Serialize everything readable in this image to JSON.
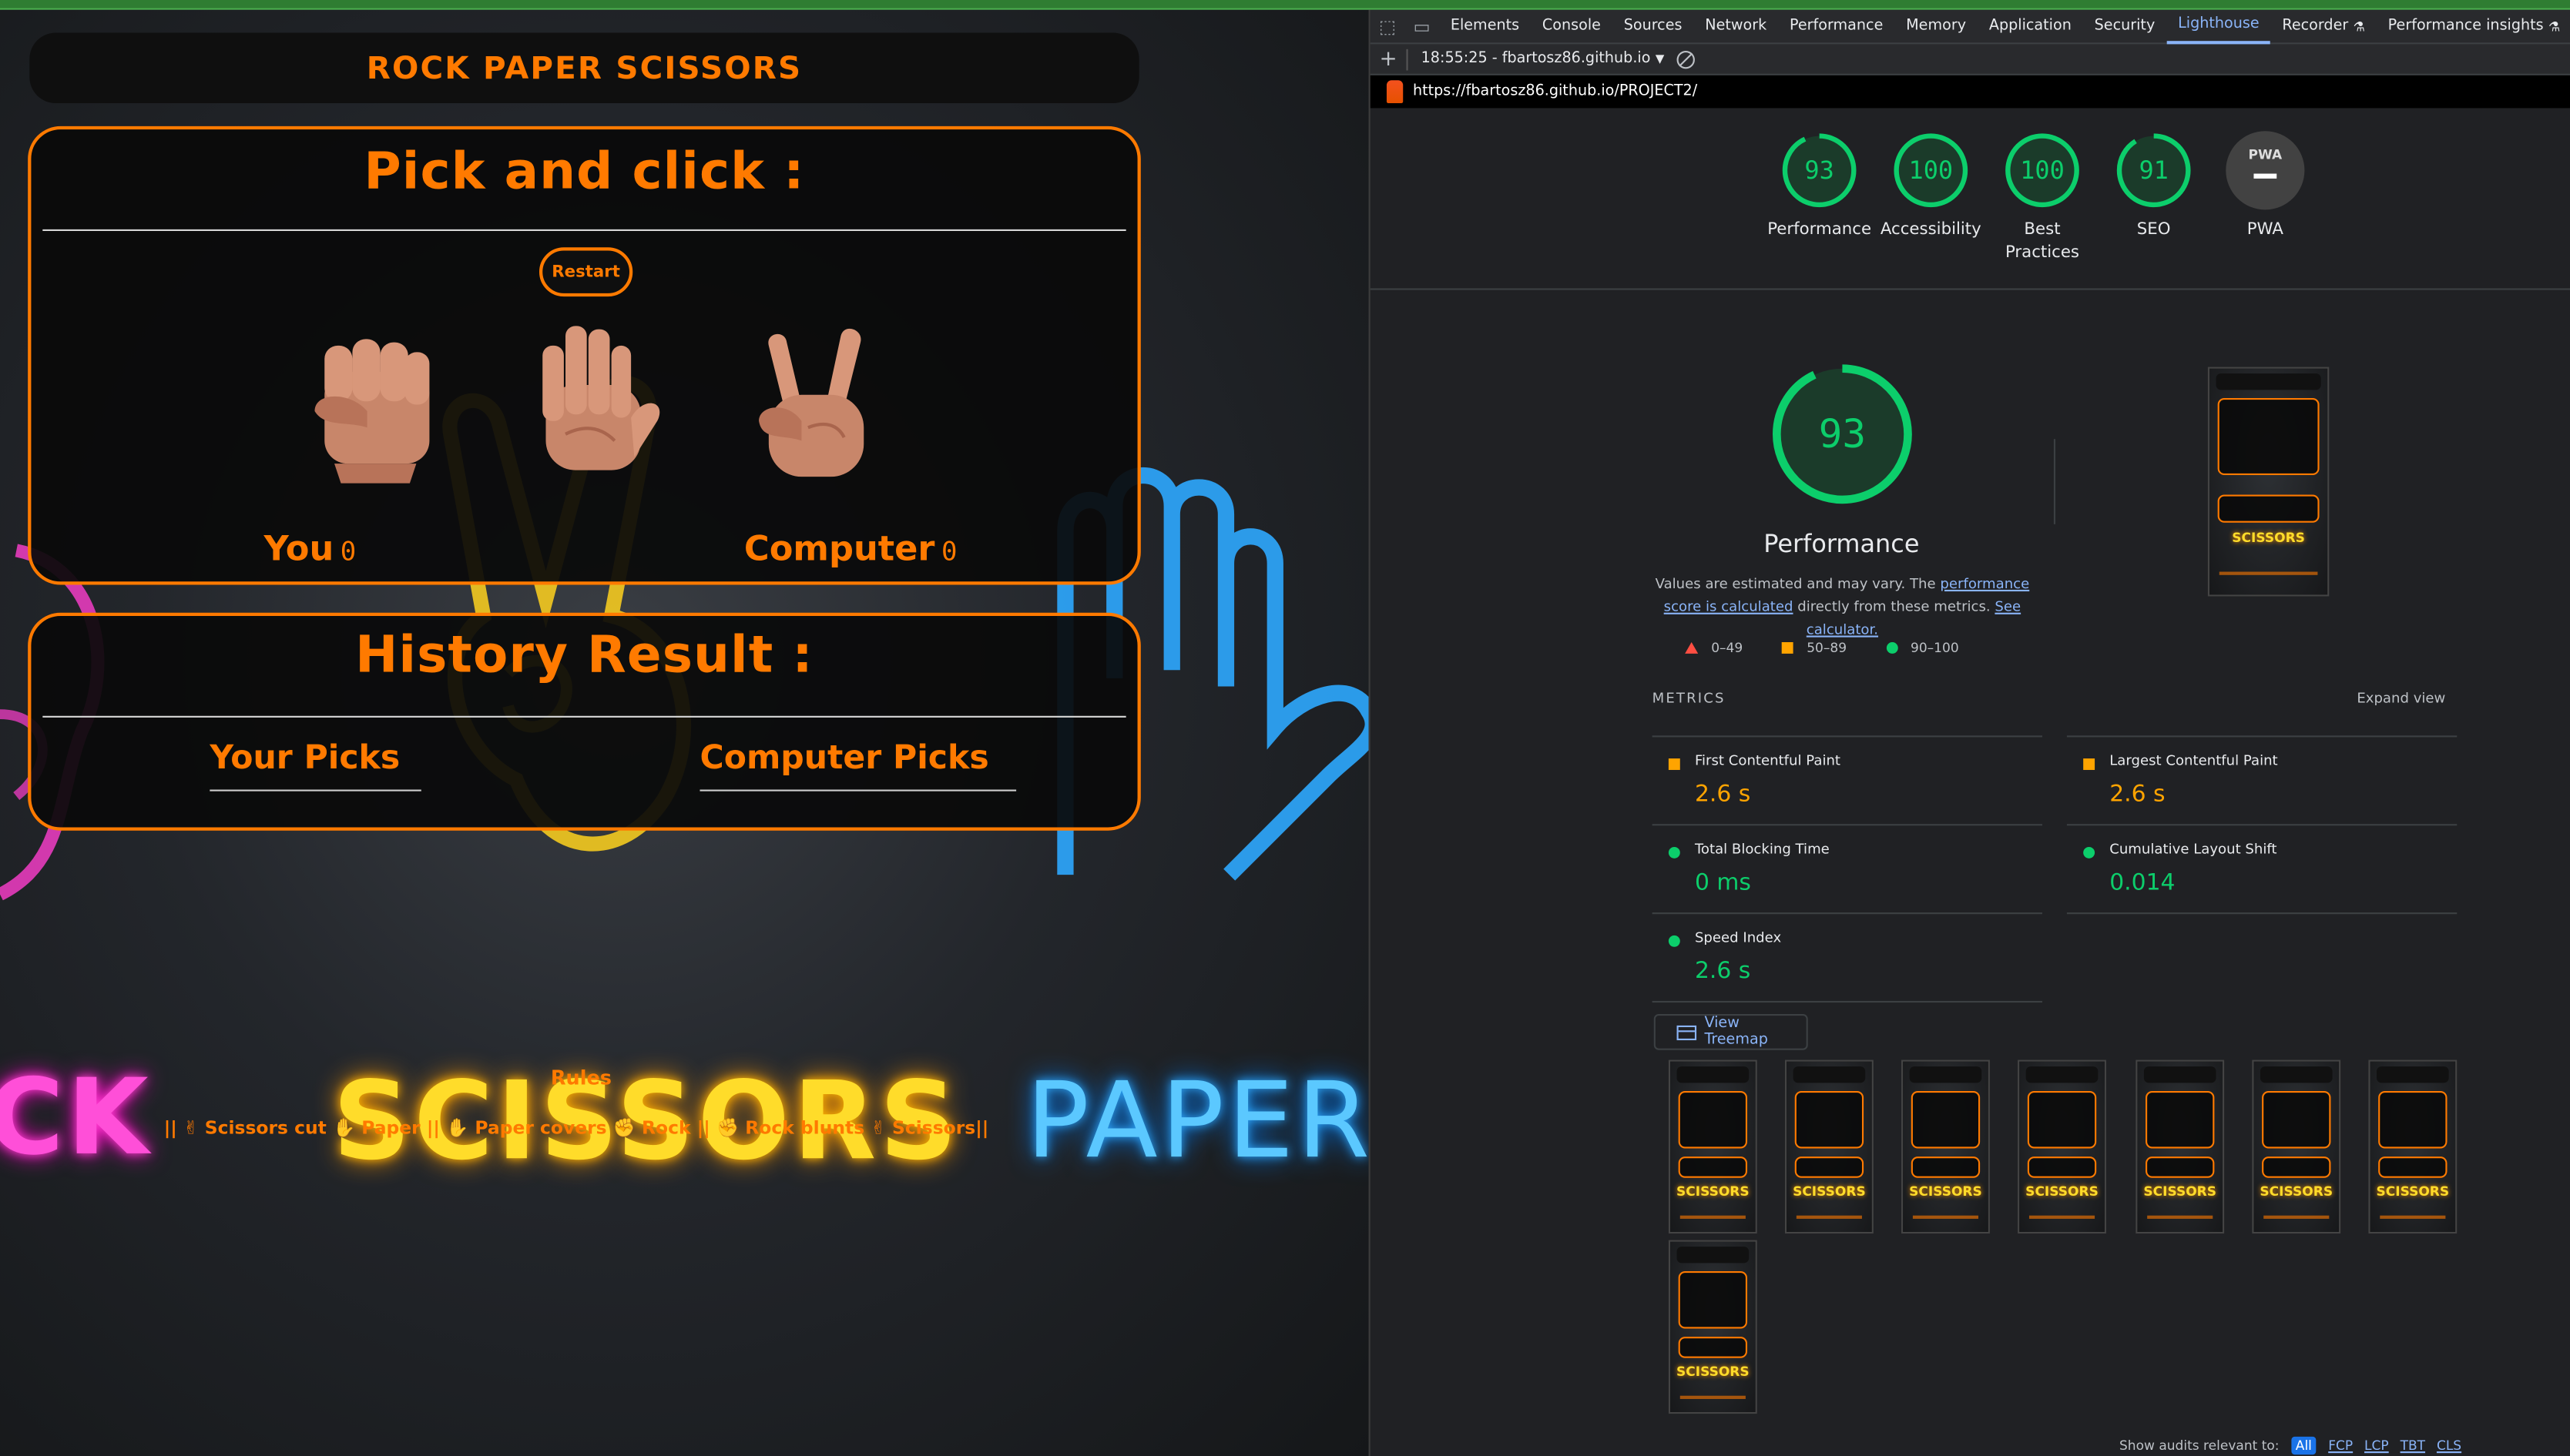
{
  "game": {
    "header_title": "ROCK PAPER SCISSORS",
    "pick_heading": "Pick and click :",
    "restart_label": "Restart",
    "hands": [
      "rock-hand-icon",
      "paper-hand-icon",
      "scissors-hand-icon"
    ],
    "you_label": "You",
    "you_score": "0",
    "computer_label": "Computer",
    "computer_score": "0",
    "history_heading": "History Result :",
    "your_picks_label": "Your Picks",
    "computer_picks_label": "Computer Picks",
    "rules_title": "Rules",
    "rules_text": "|| ✌ Scissors cut ✋ Paper || ✋ Paper covers ✊ Rock || ✊ Rock blunts ✌ Scissors||",
    "background_neon_words": [
      "CK",
      "SCISSORS",
      "PAPER"
    ]
  },
  "devtools": {
    "tabs": [
      "Elements",
      "Console",
      "Sources",
      "Network",
      "Performance",
      "Memory",
      "Application",
      "Security",
      "Lighthouse",
      "Recorder",
      "Performance insights"
    ],
    "active_tab": "Lighthouse",
    "report_selector": "18:55:25 - fbartosz86.github.io",
    "url": "https://fbartosz86.github.io/PROJECT2/",
    "gauges": [
      {
        "label": "Performance",
        "score": "93",
        "fraction": 0.93
      },
      {
        "label": "Accessibility",
        "score": "100",
        "fraction": 1.0
      },
      {
        "label": "Best Practices",
        "label_line1": "Best",
        "label_line2": "Practices",
        "score": "100",
        "fraction": 1.0
      },
      {
        "label": "SEO",
        "score": "91",
        "fraction": 0.91
      }
    ],
    "pwa": {
      "label": "PWA",
      "badge": "PWA"
    },
    "perf": {
      "score": "93",
      "fraction": 0.93,
      "title": "Performance",
      "desc_prefix": "Values are estimated and may vary. The ",
      "desc_link1": "performance score is calculated",
      "desc_middle": " directly from these metrics. ",
      "desc_link2": "See calculator."
    },
    "legend": [
      "0–49",
      "50–89",
      "90–100"
    ],
    "metrics_header": "METRICS",
    "expand_view": "Expand view",
    "metrics": [
      {
        "label": "First Contentful Paint",
        "value": "2.6 s",
        "status": "average"
      },
      {
        "label": "Largest Contentful Paint",
        "value": "2.6 s",
        "status": "average"
      },
      {
        "label": "Total Blocking Time",
        "value": "0 ms",
        "status": "pass"
      },
      {
        "label": "Cumulative Layout Shift",
        "value": "0.014",
        "status": "pass"
      },
      {
        "label": "Speed Index",
        "value": "2.6 s",
        "status": "pass"
      }
    ],
    "view_treemap": "View Treemap",
    "thumb_word": "SCISSORS",
    "show_audits": {
      "label": "Show audits relevant to:",
      "chips": [
        "All",
        "FCP",
        "LCP",
        "TBT",
        "CLS"
      ]
    },
    "colors": {
      "pass": "#0cce6b",
      "average": "#ffa400",
      "fail": "#ff4e42",
      "accent": "#8ab4f8"
    }
  }
}
